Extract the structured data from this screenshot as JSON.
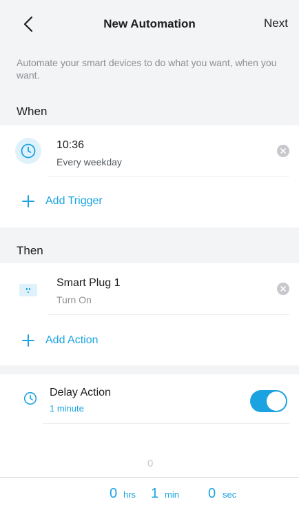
{
  "header": {
    "title": "New Automation",
    "next_label": "Next"
  },
  "description": "Automate your smart devices to do what you want, when you want.",
  "when": {
    "heading": "When",
    "trigger": {
      "time": "10:36",
      "repeat": "Every weekday",
      "icon": "clock-icon"
    },
    "add_label": "Add Trigger"
  },
  "then": {
    "heading": "Then",
    "action": {
      "device": "Smart Plug 1",
      "state": "Turn On",
      "icon": "smart-plug-icon"
    },
    "add_label": "Add Action"
  },
  "delay": {
    "title": "Delay Action",
    "value": "1 minute",
    "enabled": true
  },
  "picker": {
    "faint_value": "0",
    "hours": "0",
    "hours_unit": "hrs",
    "minutes": "1",
    "minutes_unit": "min",
    "seconds": "0",
    "seconds_unit": "sec"
  },
  "colors": {
    "accent": "#1aa3e0",
    "background": "#f3f4f6",
    "card": "#ffffff"
  }
}
